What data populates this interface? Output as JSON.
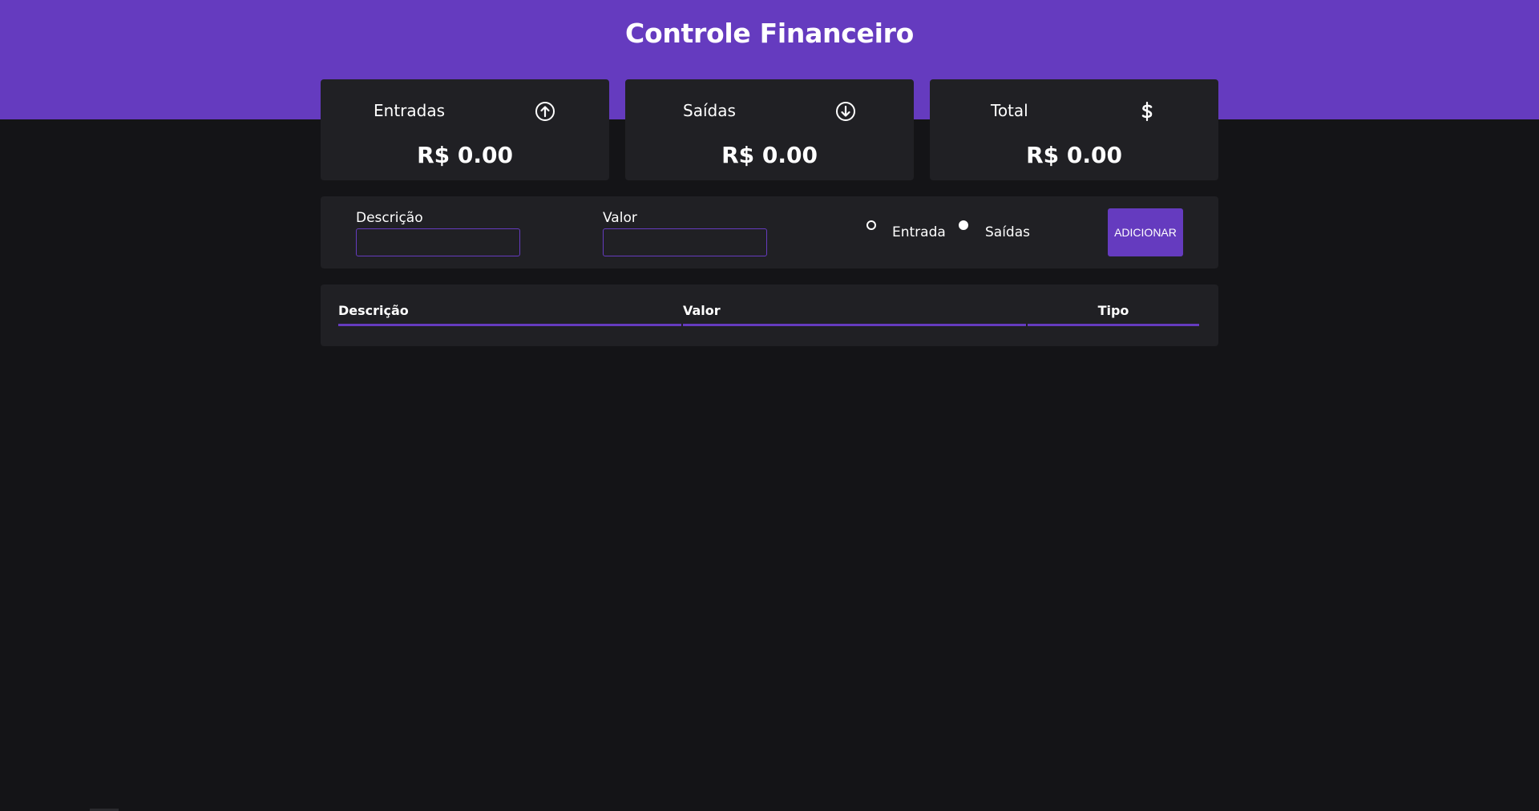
{
  "header": {
    "title": "Controle Financeiro"
  },
  "summary": {
    "cards": [
      {
        "label": "Entradas",
        "icon": "arrow-up-circle-icon",
        "value": "R$ 0.00"
      },
      {
        "label": "Saídas",
        "icon": "arrow-down-circle-icon",
        "value": "R$ 0.00"
      },
      {
        "label": "Total",
        "icon": "dollar-sign-icon",
        "value": "R$ 0.00"
      }
    ]
  },
  "form": {
    "description_label": "Descrição",
    "description_value": "",
    "amount_label": "Valor",
    "amount_value": "",
    "type_options": [
      {
        "label": "Entrada",
        "selected": false
      },
      {
        "label": "Saídas",
        "selected": true
      }
    ],
    "add_button_label": "ADICIONAR"
  },
  "table": {
    "columns": [
      "Descrição",
      "Valor",
      "Tipo"
    ],
    "rows": []
  },
  "colors": {
    "accent": "#653bbf",
    "background": "#141417",
    "panel": "#202024",
    "text": "#ffffff"
  }
}
